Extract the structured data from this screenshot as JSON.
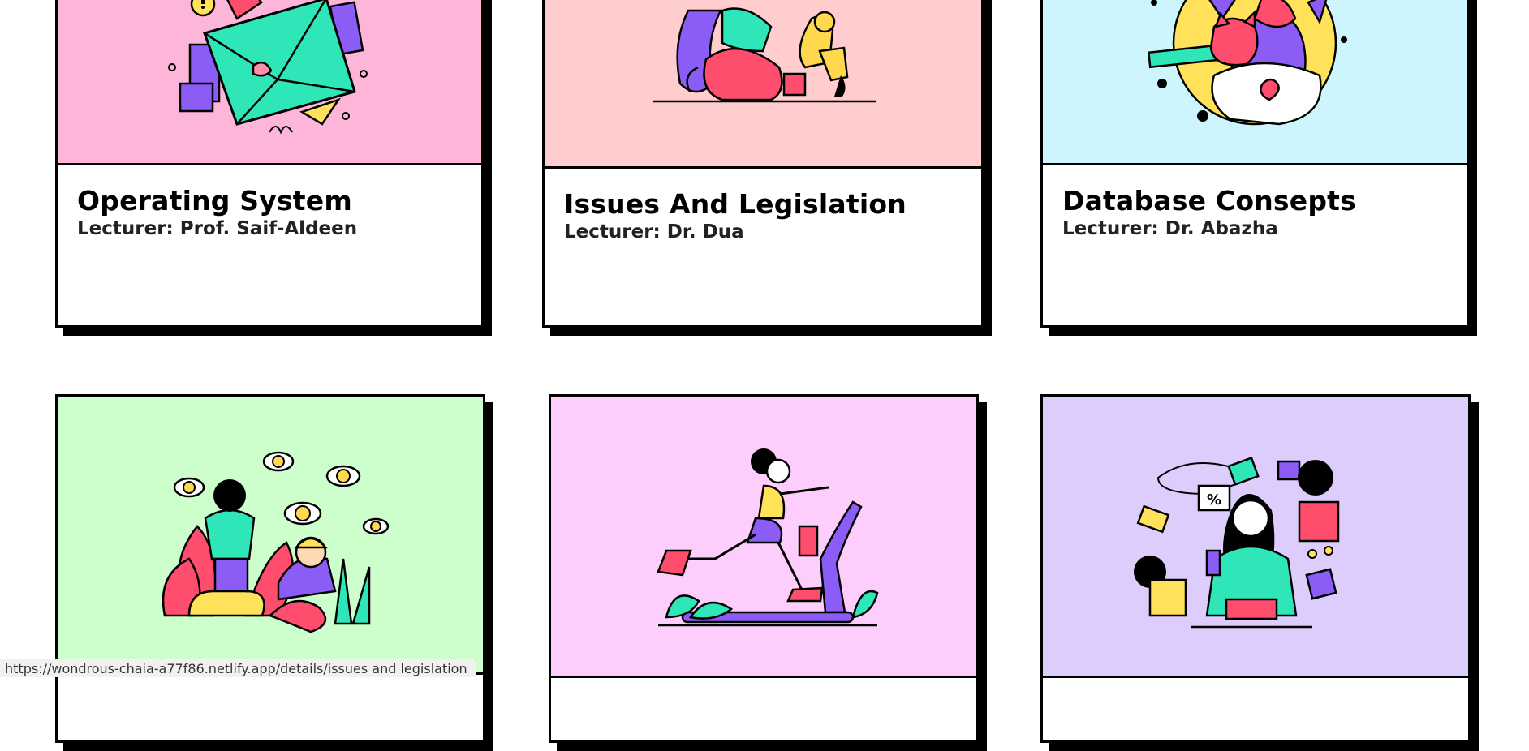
{
  "courses": [
    {
      "title": "Operating System",
      "lecturer": "Lecturer: Prof. Saif-Aldeen",
      "bg": "#fdb5d9",
      "illustration": "envelope-illustration"
    },
    {
      "title": "Issues And Legislation",
      "lecturer": "Lecturer: Dr. Dua",
      "bg": "#ffcdcd",
      "illustration": "woman-with-dog-illustration"
    },
    {
      "title": "Database Consepts",
      "lecturer": "Lecturer: Dr. Abazha",
      "bg": "#ccf5fd",
      "illustration": "woman-holding-cat-illustration"
    },
    {
      "title": "",
      "lecturer": "",
      "bg": "#ccffcc",
      "illustration": "eyes-in-jungle-illustration"
    },
    {
      "title": "",
      "lecturer": "",
      "bg": "#fdcdfb",
      "illustration": "treadmill-runner-illustration"
    },
    {
      "title": "",
      "lecturer": "",
      "bg": "#dccdfd",
      "illustration": "online-shopping-illustration"
    }
  ],
  "status_url": "https://wondrous-chaia-a77f86.netlify.app/details/issues and legislation"
}
